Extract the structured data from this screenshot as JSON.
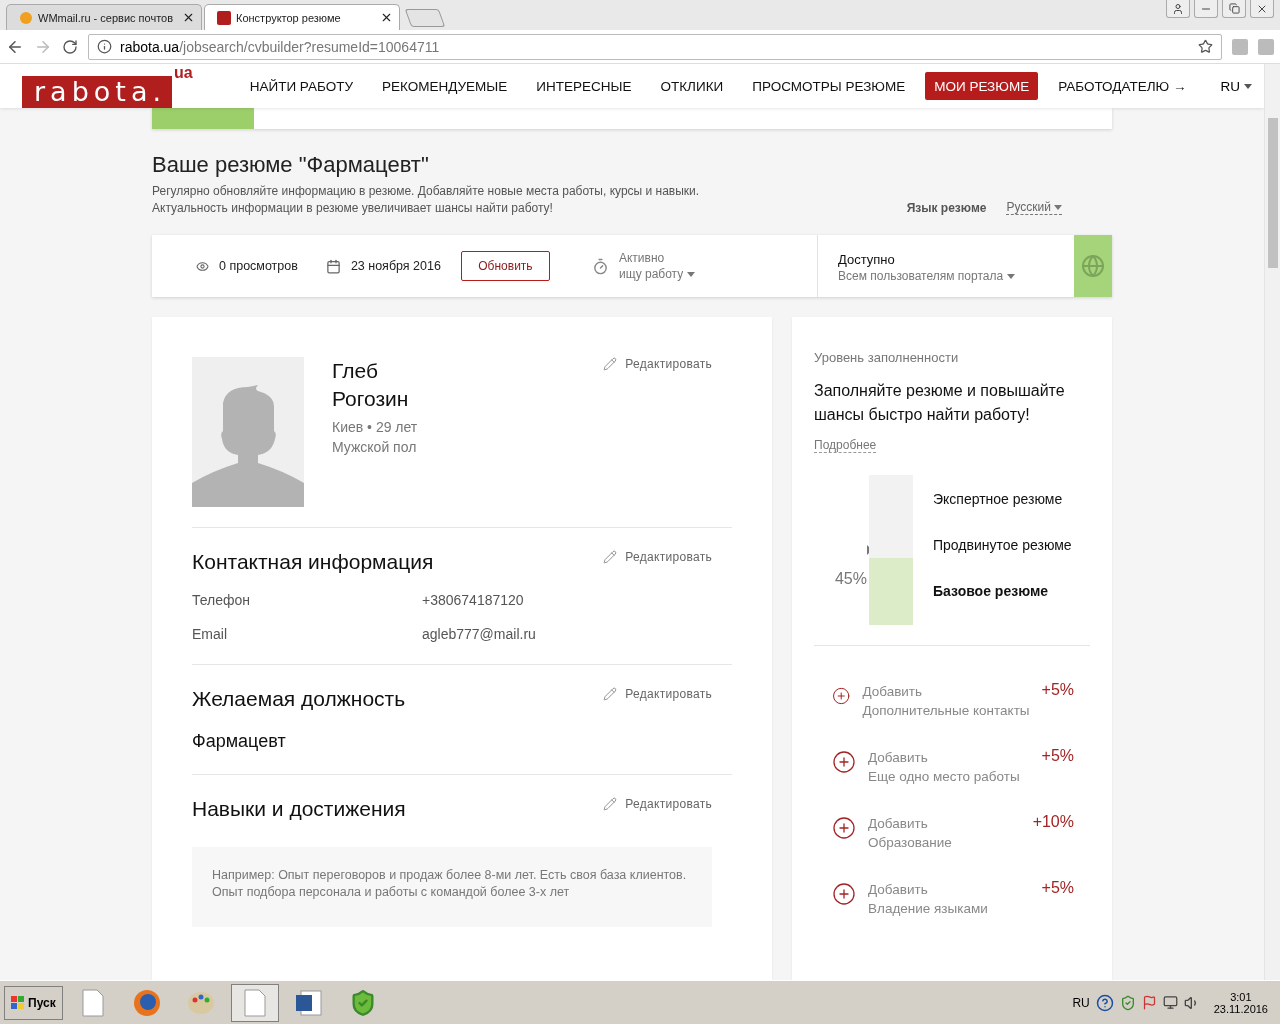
{
  "browser": {
    "tabs": [
      {
        "title": "WMmail.ru - сервис почтов",
        "selected": false
      },
      {
        "title": "Конструктор резюме",
        "selected": true
      }
    ],
    "address": {
      "host": "rabota.ua",
      "path": "/jobsearch/cvbuilder?resumeId=10064711"
    }
  },
  "header": {
    "logo_text": "rabota.",
    "logo_domain": "ua",
    "nav": [
      {
        "label": "НАЙТИ РАБОТУ",
        "selected": false
      },
      {
        "label": "РЕКОМЕНДУЕМЫЕ",
        "selected": false
      },
      {
        "label": "ИНТЕРЕСНЫЕ",
        "selected": false
      },
      {
        "label": "ОТКЛИКИ",
        "selected": false
      },
      {
        "label": "ПРОСМОТРЫ РЕЗЮМЕ",
        "selected": false
      },
      {
        "label": "МОИ РЕЗЮМЕ",
        "selected": true
      },
      {
        "label": "РАБОТОДАТЕЛЮ →",
        "selected": false
      }
    ],
    "language": "RU"
  },
  "title": "Ваше резюме \"Фармацевт\"",
  "subtitle": [
    "Регулярно обновляйте информацию в резюме. Добавляйте новые места работы, курсы и навыки.",
    "Актуальность информации в резюме увеличивает шансы найти работу!"
  ],
  "resume_language": {
    "label": "Язык резюме",
    "value": "Русский"
  },
  "stats": {
    "views": "0 просмотров",
    "date": "23 ноября 2016",
    "refresh_button": "Обновить",
    "status_line1": "Активно",
    "status_line2": "ищу работу",
    "visibility_title": "Доступно",
    "visibility_value": "Всем пользователям портала"
  },
  "profile": {
    "first_name": "Глеб",
    "last_name": "Рогозин",
    "city_age": "Киев • 29 лет",
    "gender": "Мужской пол",
    "edit": "Редактировать"
  },
  "contacts": {
    "title": "Контактная информация",
    "edit": "Редактировать",
    "rows": [
      {
        "label": "Телефон",
        "value": "+380674187120"
      },
      {
        "label": "Email",
        "value": "agleb777@mail.ru"
      }
    ]
  },
  "position": {
    "title": "Желаемая должность",
    "edit": "Редактировать",
    "value": "Фармацевт"
  },
  "skills": {
    "title": "Навыки и достижения",
    "edit": "Редактировать",
    "placeholder": "Например: Опыт переговоров и продаж более 8-ми лет. Есть своя база клиентов. Опыт подбора персонала и работы с командой более 3-х лет"
  },
  "completeness": {
    "label": "Уровень заполненности",
    "headline": "Заполняйте резюме и повышайте шансы быстро найти работу!",
    "more_link": "Подробнее",
    "level": 0.45,
    "percent": "45%",
    "levels": [
      {
        "label": "Экспертное резюме",
        "current": false
      },
      {
        "label": "Продвинутое резюме",
        "current": false
      },
      {
        "label": "Базовое резюме",
        "current": true
      }
    ],
    "suggestions": [
      {
        "action": "Добавить",
        "item": "Дополнительные контакты",
        "bonus": "+5%"
      },
      {
        "action": "Добавить",
        "item": "Еще одно место работы",
        "bonus": "+5%"
      },
      {
        "action": "Добавить",
        "item": "Образование",
        "bonus": "+10%"
      },
      {
        "action": "Добавить",
        "item": "Владение языками",
        "bonus": "+5%"
      }
    ]
  },
  "taskbar": {
    "start": "Пуск",
    "language": "RU",
    "time": "3:01",
    "date": "23.11.2016"
  }
}
